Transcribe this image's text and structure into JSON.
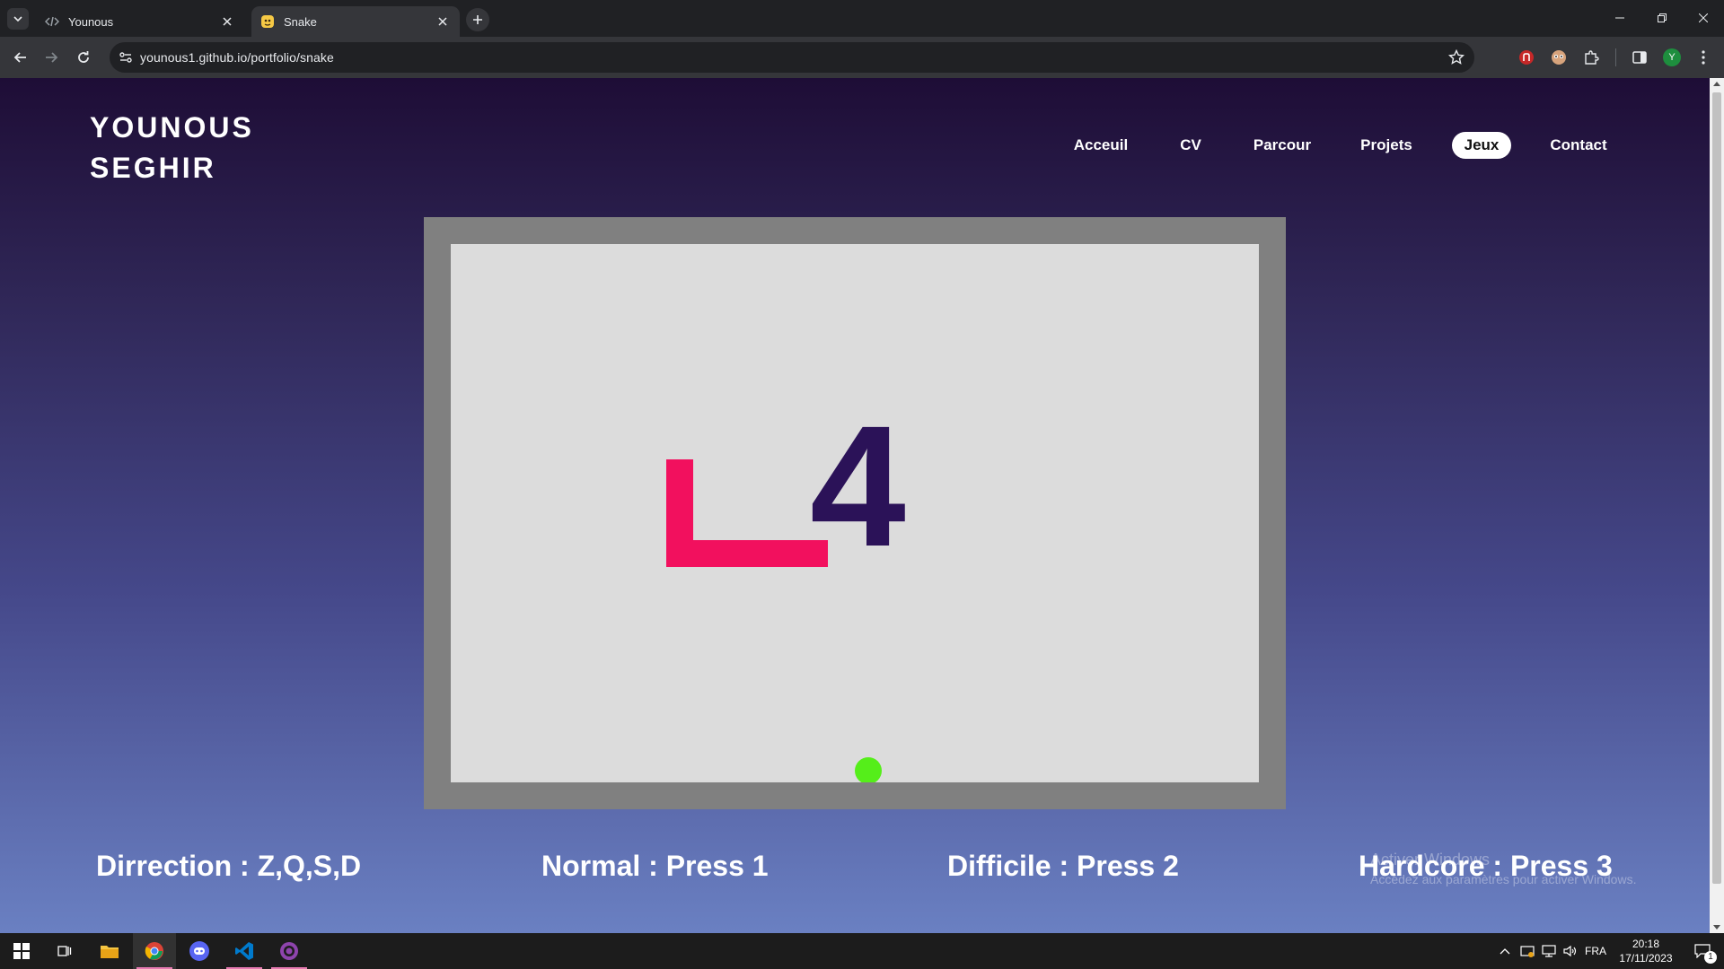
{
  "browser": {
    "tabs": [
      {
        "title": "Younous",
        "active": false
      },
      {
        "title": "Snake",
        "active": true
      }
    ],
    "url": "younous1.github.io/portfolio/snake",
    "profile_initial": "Y"
  },
  "site": {
    "logo_line1": "YOUNOUS",
    "logo_line2": "SEGHIR",
    "nav": [
      {
        "label": "Acceuil"
      },
      {
        "label": "CV"
      },
      {
        "label": "Parcour"
      },
      {
        "label": "Projets"
      },
      {
        "label": "Jeux",
        "current": true
      },
      {
        "label": "Contact"
      }
    ]
  },
  "game": {
    "score": "4",
    "snake_color": "#f2105e",
    "food_color": "#55ee1a",
    "board_color": "#dcdcdc",
    "frame_color": "#808080",
    "score_color": "#2b1258"
  },
  "controls": {
    "direction": "Dirrection : Z,Q,S,D",
    "normal": "Normal : Press 1",
    "difficile": "Difficile : Press 2",
    "hardcore": "Hardcore : Press 3"
  },
  "watermark": {
    "title": "Activer Windows",
    "subtitle": "Accédez aux paramètres pour activer Windows."
  },
  "taskbar": {
    "language": "FRA",
    "time": "20:18",
    "date": "17/11/2023",
    "notification_count": "1"
  }
}
